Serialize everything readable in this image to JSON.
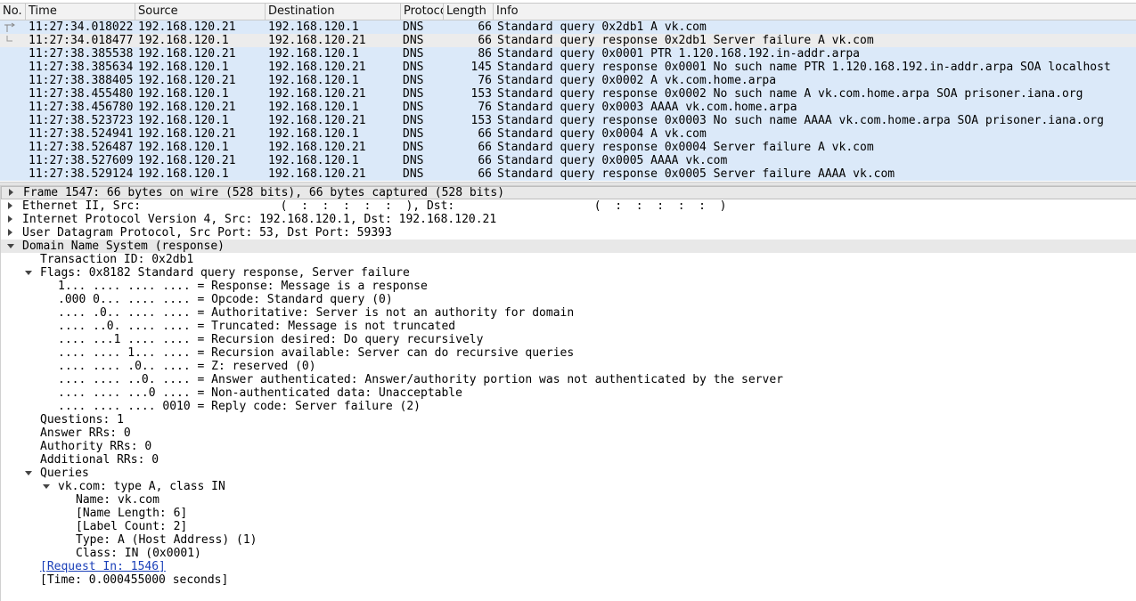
{
  "packet_list": {
    "columns": [
      "No.",
      "Time",
      "Source",
      "Destination",
      "Protocol",
      "Length",
      "Info"
    ],
    "rows": [
      {
        "no": "",
        "time": "11:27:34.018022",
        "src": "192.168.120.21",
        "dst": "192.168.120.1",
        "proto": "DNS",
        "len": "66",
        "info": "Standard query 0x2db1 A vk.com"
      },
      {
        "no": "",
        "time": "11:27:34.018477",
        "src": "192.168.120.1",
        "dst": "192.168.120.21",
        "proto": "DNS",
        "len": "66",
        "info": "Standard query response 0x2db1 Server failure A vk.com"
      },
      {
        "no": "",
        "time": "11:27:38.385538",
        "src": "192.168.120.21",
        "dst": "192.168.120.1",
        "proto": "DNS",
        "len": "86",
        "info": "Standard query 0x0001 PTR 1.120.168.192.in-addr.arpa"
      },
      {
        "no": "",
        "time": "11:27:38.385634",
        "src": "192.168.120.1",
        "dst": "192.168.120.21",
        "proto": "DNS",
        "len": "145",
        "info": "Standard query response 0x0001 No such name PTR 1.120.168.192.in-addr.arpa SOA localhost"
      },
      {
        "no": "",
        "time": "11:27:38.388405",
        "src": "192.168.120.21",
        "dst": "192.168.120.1",
        "proto": "DNS",
        "len": "76",
        "info": "Standard query 0x0002 A vk.com.home.arpa"
      },
      {
        "no": "",
        "time": "11:27:38.455480",
        "src": "192.168.120.1",
        "dst": "192.168.120.21",
        "proto": "DNS",
        "len": "153",
        "info": "Standard query response 0x0002 No such name A vk.com.home.arpa SOA prisoner.iana.org"
      },
      {
        "no": "",
        "time": "11:27:38.456780",
        "src": "192.168.120.21",
        "dst": "192.168.120.1",
        "proto": "DNS",
        "len": "76",
        "info": "Standard query 0x0003 AAAA vk.com.home.arpa"
      },
      {
        "no": "",
        "time": "11:27:38.523723",
        "src": "192.168.120.1",
        "dst": "192.168.120.21",
        "proto": "DNS",
        "len": "153",
        "info": "Standard query response 0x0003 No such name AAAA vk.com.home.arpa SOA prisoner.iana.org"
      },
      {
        "no": "",
        "time": "11:27:38.524941",
        "src": "192.168.120.21",
        "dst": "192.168.120.1",
        "proto": "DNS",
        "len": "66",
        "info": "Standard query 0x0004 A vk.com"
      },
      {
        "no": "",
        "time": "11:27:38.526487",
        "src": "192.168.120.1",
        "dst": "192.168.120.21",
        "proto": "DNS",
        "len": "66",
        "info": "Standard query response 0x0004 Server failure A vk.com"
      },
      {
        "no": "",
        "time": "11:27:38.527609",
        "src": "192.168.120.21",
        "dst": "192.168.120.1",
        "proto": "DNS",
        "len": "66",
        "info": "Standard query 0x0005 AAAA vk.com"
      },
      {
        "no": "",
        "time": "11:27:38.529124",
        "src": "192.168.120.1",
        "dst": "192.168.120.21",
        "proto": "DNS",
        "len": "66",
        "info": "Standard query response 0x0005 Server failure AAAA vk.com"
      }
    ],
    "selected_row": 1
  },
  "detail_tree": [
    {
      "indent": 0,
      "toggle": "closed",
      "text": "Frame 1547: 66 bytes on wire (528 bits), 66 bytes captured (528 bits)",
      "style": "first"
    },
    {
      "indent": 0,
      "toggle": "closed",
      "text": "Ethernet II, Src:                    (  :  :  :  :  :  ), Dst:                    (  :  :  :  :  :  )"
    },
    {
      "indent": 0,
      "toggle": "closed",
      "text": "Internet Protocol Version 4, Src: 192.168.120.1, Dst: 192.168.120.21"
    },
    {
      "indent": 0,
      "toggle": "closed",
      "text": "User Datagram Protocol, Src Port: 53, Dst Port: 59393"
    },
    {
      "indent": 0,
      "toggle": "open",
      "text": "Domain Name System (response)",
      "style": "hl"
    },
    {
      "indent": 1,
      "toggle": "",
      "text": "Transaction ID: 0x2db1"
    },
    {
      "indent": 1,
      "toggle": "open",
      "text": "Flags: 0x8182 Standard query response, Server failure"
    },
    {
      "indent": 2,
      "toggle": "",
      "text": "1... .... .... .... = Response: Message is a response"
    },
    {
      "indent": 2,
      "toggle": "",
      "text": ".000 0... .... .... = Opcode: Standard query (0)"
    },
    {
      "indent": 2,
      "toggle": "",
      "text": ".... .0.. .... .... = Authoritative: Server is not an authority for domain"
    },
    {
      "indent": 2,
      "toggle": "",
      "text": ".... ..0. .... .... = Truncated: Message is not truncated"
    },
    {
      "indent": 2,
      "toggle": "",
      "text": ".... ...1 .... .... = Recursion desired: Do query recursively"
    },
    {
      "indent": 2,
      "toggle": "",
      "text": ".... .... 1... .... = Recursion available: Server can do recursive queries"
    },
    {
      "indent": 2,
      "toggle": "",
      "text": ".... .... .0.. .... = Z: reserved (0)"
    },
    {
      "indent": 2,
      "toggle": "",
      "text": ".... .... ..0. .... = Answer authenticated: Answer/authority portion was not authenticated by the server"
    },
    {
      "indent": 2,
      "toggle": "",
      "text": ".... .... ...0 .... = Non-authenticated data: Unacceptable"
    },
    {
      "indent": 2,
      "toggle": "",
      "text": ".... .... .... 0010 = Reply code: Server failure (2)"
    },
    {
      "indent": 1,
      "toggle": "",
      "text": "Questions: 1"
    },
    {
      "indent": 1,
      "toggle": "",
      "text": "Answer RRs: 0"
    },
    {
      "indent": 1,
      "toggle": "",
      "text": "Authority RRs: 0"
    },
    {
      "indent": 1,
      "toggle": "",
      "text": "Additional RRs: 0"
    },
    {
      "indent": 1,
      "toggle": "open",
      "text": "Queries"
    },
    {
      "indent": 2,
      "toggle": "open",
      "text": "vk.com: type A, class IN"
    },
    {
      "indent": 3,
      "toggle": "",
      "text": "Name: vk.com"
    },
    {
      "indent": 3,
      "toggle": "",
      "text": "[Name Length: 6]"
    },
    {
      "indent": 3,
      "toggle": "",
      "text": "[Label Count: 2]"
    },
    {
      "indent": 3,
      "toggle": "",
      "text": "Type: A (Host Address) (1)"
    },
    {
      "indent": 3,
      "toggle": "",
      "text": "Class: IN (0x0001)"
    },
    {
      "indent": 1,
      "toggle": "",
      "text": "[Request In: 1546]",
      "style": "link"
    },
    {
      "indent": 1,
      "toggle": "",
      "text": "[Time: 0.000455000 seconds]"
    }
  ]
}
